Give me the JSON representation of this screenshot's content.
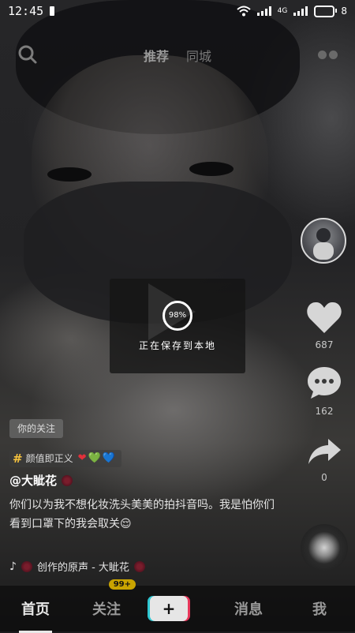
{
  "status_bar": {
    "time": "12:45",
    "network": "4G",
    "battery": "8"
  },
  "top_nav": {
    "tabs": [
      {
        "label": "推荐"
      },
      {
        "label": "同城"
      }
    ]
  },
  "right_rail": {
    "like_count": "687",
    "comment_count": "162",
    "share_count": "0"
  },
  "saving_overlay": {
    "progress": "98%",
    "message": "正在保存到本地"
  },
  "caption": {
    "follow_badge": "你的关注",
    "hashtag": "颜值即正义",
    "hashtag_emojis": [
      "❤",
      "💚",
      "💙"
    ],
    "author": "@大眦花",
    "description": "你们以为我不想化妆洗头美美的拍抖音吗。我是怕你们看到口罩下的我会取关😌",
    "music": "创作的原声 - 大眦花"
  },
  "bottom_nav": {
    "items": [
      {
        "label": "首页"
      },
      {
        "label": "关注"
      },
      {
        "label": "+"
      },
      {
        "label": "消息"
      },
      {
        "label": "我"
      }
    ],
    "follow_badge": "99+"
  }
}
